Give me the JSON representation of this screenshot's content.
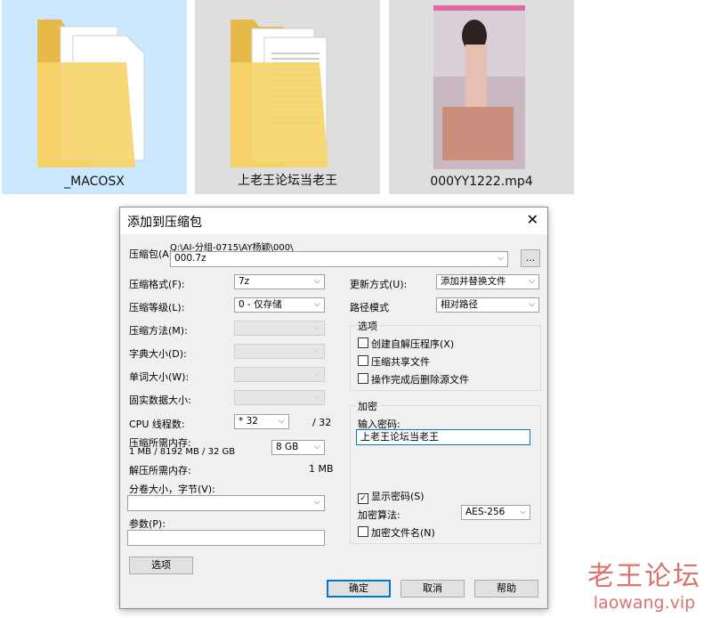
{
  "explorer": {
    "items": [
      {
        "name": "_MACOSX"
      },
      {
        "name": "上老王论坛当老王"
      },
      {
        "name": "000YY1222.mp4"
      }
    ]
  },
  "dialog": {
    "title": "添加到压缩包",
    "close_glyph": "✕",
    "archive": {
      "label": "压缩包(A)",
      "path": "Q:\\AI-分组-0715\\AY杨颖\\000\\",
      "value": "000.7z",
      "browse_label": "..."
    },
    "format": {
      "label": "压缩格式(F):",
      "value": "7z"
    },
    "level": {
      "label": "压缩等级(L):",
      "value": "0 - 仅存储"
    },
    "method": {
      "label": "压缩方法(M):",
      "value": ""
    },
    "dict_size": {
      "label": "字典大小(D):",
      "value": ""
    },
    "word_size": {
      "label": "单词大小(W):",
      "value": ""
    },
    "solid_size": {
      "label": "固实数据大小:",
      "value": ""
    },
    "cpu": {
      "label": "CPU 线程数:",
      "value": "* 32",
      "total": "/ 32"
    },
    "mem_compress": {
      "label": "压缩所需内存:",
      "detail": "1 MB / 8192 MB / 32 GB",
      "value": "8 GB"
    },
    "mem_decompress": {
      "label": "解压所需内存:",
      "value": "1 MB"
    },
    "volume": {
      "label": "分卷大小，字节(V):",
      "value": ""
    },
    "params": {
      "label": "参数(P):",
      "value": ""
    },
    "options_button": "选项",
    "update_mode": {
      "label": "更新方式(U):",
      "value": "添加并替换文件"
    },
    "path_mode": {
      "label": "路径模式",
      "value": "相对路径"
    },
    "options_group": {
      "title": "选项",
      "sfx": "创建自解压程序(X)",
      "shared": "压缩共享文件",
      "delete_after": "操作完成后删除源文件"
    },
    "encryption": {
      "title": "加密",
      "password_label": "输入密码:",
      "password_value": "上老王论坛当老王",
      "show_password": "显示密码(S)",
      "show_password_checked": "✓",
      "method_label": "加密算法:",
      "method_value": "AES-256",
      "encrypt_names": "加密文件名(N)"
    },
    "buttons": {
      "ok": "确定",
      "cancel": "取消",
      "help": "帮助"
    }
  },
  "watermark": {
    "text": "老王论坛",
    "url": "laowang.vip"
  },
  "colors": {
    "selection": "#cce8ff",
    "tile_bg": "#dedede",
    "accent": "#0078d7",
    "watermark": "#d9746f"
  }
}
